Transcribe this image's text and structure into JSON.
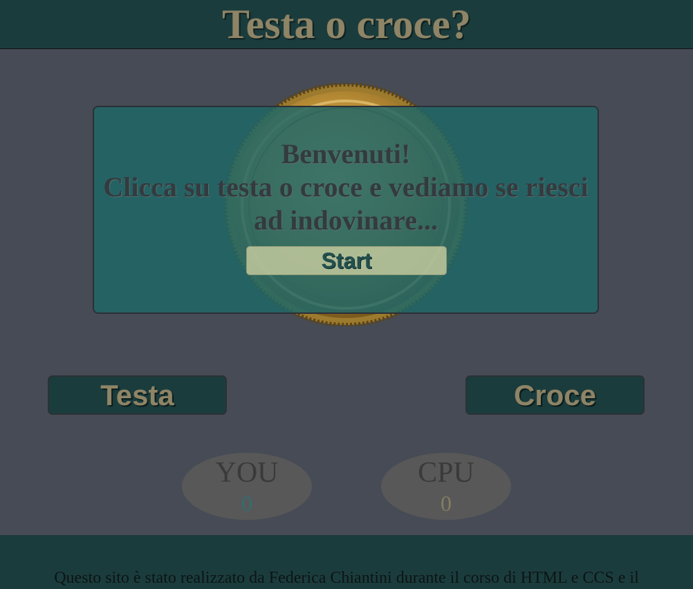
{
  "header": {
    "title": "Testa o croce?"
  },
  "coin": {
    "icon": "gold-coin-icon",
    "color": "#c49a3c"
  },
  "modal": {
    "line1": "Benvenuti!",
    "line2": "Clicca su testa o croce e vediamo se riesci",
    "line3": "ad indovinare...",
    "start_label": "Start"
  },
  "choices": {
    "testa_label": "Testa",
    "croce_label": "Croce"
  },
  "scores": {
    "you": {
      "label": "YOU",
      "value": "0"
    },
    "cpu": {
      "label": "CPU",
      "value": "0"
    }
  },
  "footer": {
    "text": "Questo sito è stato realizzato da Federica Chiantini durante il corso di HTML e CCS e il"
  },
  "colors": {
    "background": "#464b55",
    "header": "#1b3c3d",
    "accent_text": "#8e8466",
    "modal": "#1f6668"
  }
}
